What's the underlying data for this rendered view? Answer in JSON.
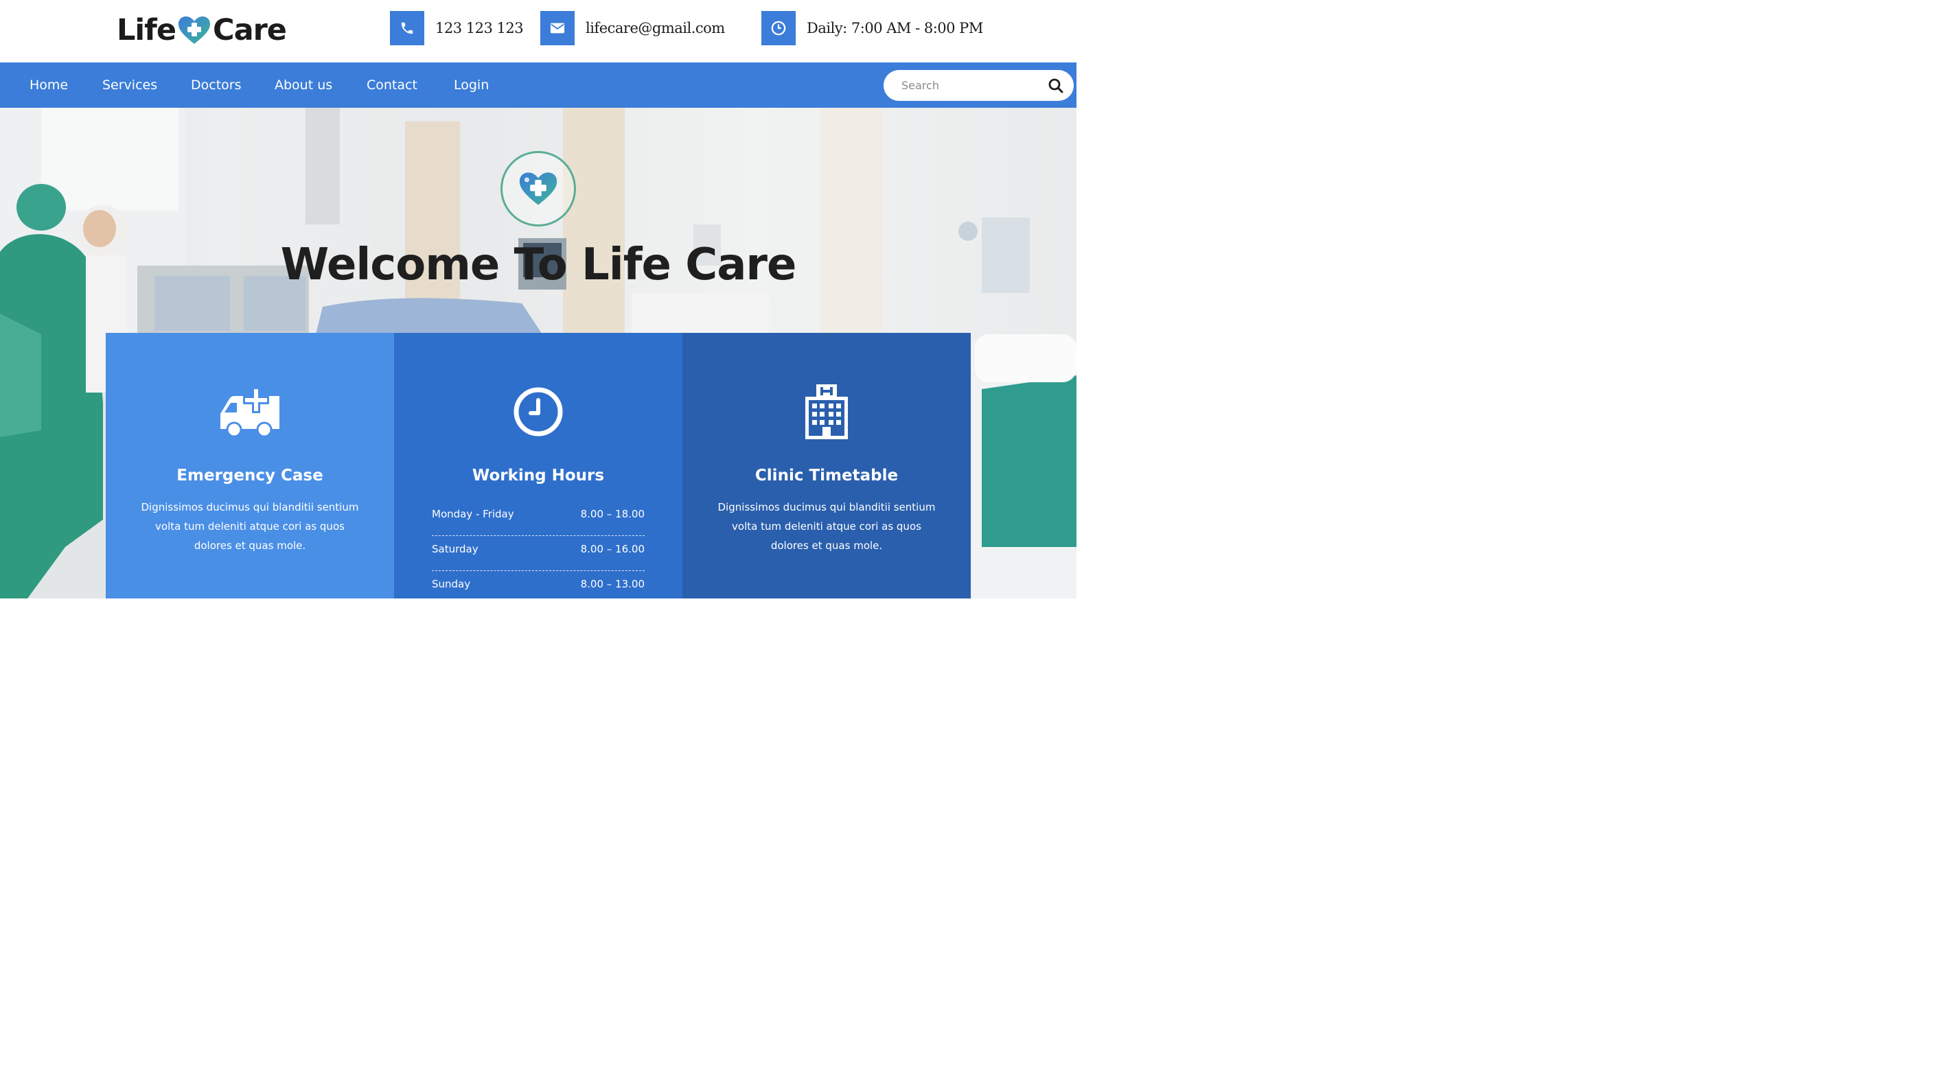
{
  "brand": {
    "name_part1": "Life",
    "name_part2": "Care"
  },
  "contact": {
    "phone": "123 123 123",
    "email": "lifecare@gmail.com",
    "hours": "Daily: 7:00 AM - 8:00 PM"
  },
  "nav": {
    "items": [
      "Home",
      "Services",
      "Doctors",
      "About us",
      "Contact",
      "Login"
    ],
    "search_placeholder": "Search"
  },
  "hero": {
    "title": "Welcome To Life Care"
  },
  "cards": [
    {
      "title": "Emergency Case",
      "text": "Dignissimos ducimus qui blanditii sentium volta tum deleniti atque cori as quos dolores et quas mole.",
      "color": "#4a8fe6",
      "icon": "ambulance-icon"
    },
    {
      "title": "Working Hours",
      "color": "#2f6fcc",
      "icon": "clock-icon",
      "hours": [
        {
          "day": "Monday - Friday",
          "time": "8.00 – 18.00"
        },
        {
          "day": "Saturday",
          "time": "8.00 – 16.00"
        },
        {
          "day": "Sunday",
          "time": "8.00 – 13.00"
        }
      ]
    },
    {
      "title": "Clinic Timetable",
      "text": "Dignissimos ducimus qui blanditii sentium volta tum deleniti atque cori as quos dolores et quas mole.",
      "color": "#2a5fad",
      "icon": "hospital-icon"
    }
  ],
  "colors": {
    "primary": "#3b7dd8",
    "accent_green": "#5aae94"
  }
}
